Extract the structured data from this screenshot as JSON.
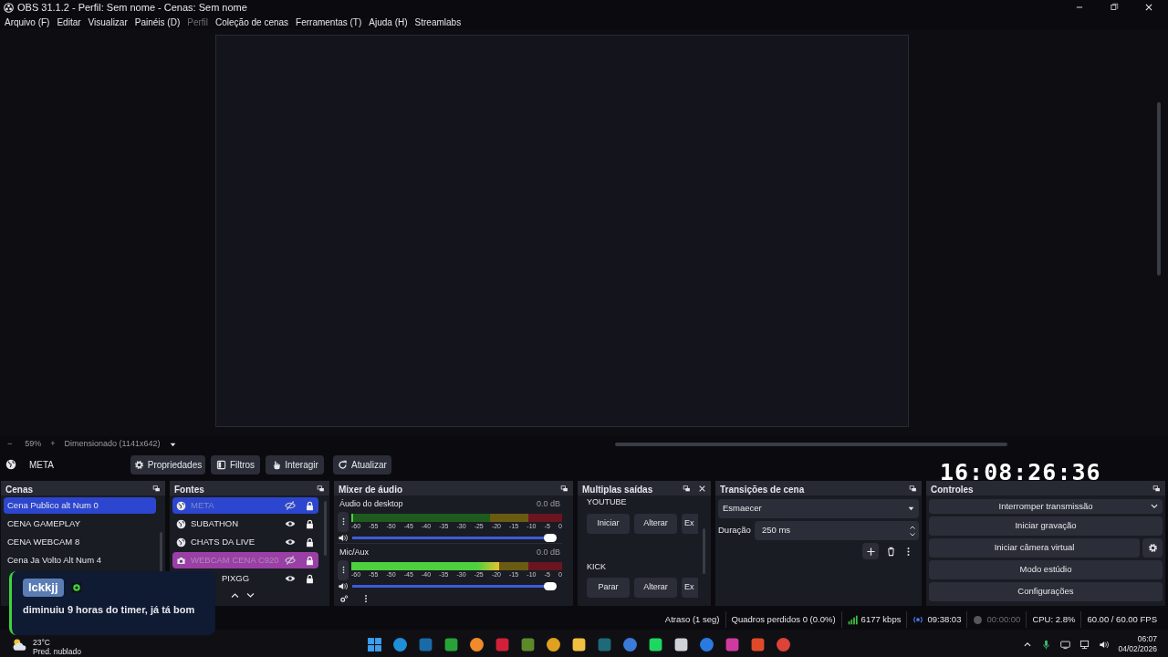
{
  "window": {
    "title": "OBS 31.1.2 - Perfil: Sem nome - Cenas: Sem nome"
  },
  "menu": [
    {
      "label": "Arquivo (F)",
      "disabled": false
    },
    {
      "label": "Editar",
      "disabled": false
    },
    {
      "label": "Visualizar",
      "disabled": false
    },
    {
      "label": "Painéis (D)",
      "disabled": false
    },
    {
      "label": "Perfil",
      "disabled": true
    },
    {
      "label": "Coleção de cenas",
      "disabled": false
    },
    {
      "label": "Ferramentas (T)",
      "disabled": false
    },
    {
      "label": "Ajuda (H)",
      "disabled": false
    },
    {
      "label": "Streamlabs",
      "disabled": false
    }
  ],
  "preview_bar": {
    "zoom_out": "−",
    "zoom": "59%",
    "zoom_in": "+",
    "mode": "Dimensionado (1141x642)"
  },
  "source_toolbar": {
    "source": "META",
    "buttons": [
      {
        "label": "Propriedades",
        "kind": "gear"
      },
      {
        "label": "Filtros",
        "kind": "filter"
      },
      {
        "label": "Interagir",
        "kind": "hand"
      },
      {
        "label": "Atualizar",
        "kind": "refresh"
      }
    ]
  },
  "clock": "16:08:26:36",
  "scenes": {
    "title": "Cenas",
    "items": [
      {
        "label": "Cena Publico alt Num 0",
        "selected": true
      },
      {
        "label": "CENA GAMEPLAY",
        "selected": false
      },
      {
        "label": "CENA WEBCAM 8",
        "selected": false
      },
      {
        "label": "Cena Ja Volto Alt Num 4",
        "selected": false
      }
    ]
  },
  "sources": {
    "title": "Fontes",
    "items": [
      {
        "label": "META",
        "kind": "browser",
        "visible": false,
        "locked": true,
        "selected": true,
        "covered": false
      },
      {
        "label": "SUBATHON",
        "kind": "browser",
        "visible": true,
        "locked": true,
        "selected": false,
        "covered": false
      },
      {
        "label": "CHATS DA LIVE",
        "kind": "browser",
        "visible": true,
        "locked": true,
        "selected": false,
        "covered": false
      },
      {
        "label": "WEBCAM CENA C920",
        "kind": "camera",
        "visible": false,
        "locked": true,
        "selected": false,
        "covered": false,
        "color": "#9a3fa6"
      },
      {
        "label": "PIXGG",
        "kind": "browser",
        "visible": true,
        "locked": true,
        "selected": false,
        "covered": true
      }
    ]
  },
  "mixer": {
    "title": "Mixer de áudio",
    "channels": [
      {
        "name": "Áudio do desktop",
        "reading": "0.0 dB",
        "meter": {
          "level": 0.01
        },
        "fader": {
          "level": 1
        },
        "scale": [
          "-60",
          "-55",
          "-50",
          "-45",
          "-40",
          "-35",
          "-30",
          "-25",
          "-20",
          "-15",
          "-10",
          "-5",
          "0"
        ]
      },
      {
        "name": "Mic/Aux",
        "reading": "0.0 dB",
        "meter": {
          "level": 0.7
        },
        "fader": {
          "level": 1
        },
        "scale": [
          "-60",
          "-55",
          "-50",
          "-45",
          "-40",
          "-35",
          "-30",
          "-25",
          "-20",
          "-15",
          "-10",
          "-5",
          "0"
        ]
      }
    ]
  },
  "outputs": {
    "title": "Multiplas saídas",
    "services": [
      {
        "name": "YOUTUBE",
        "buttons": [
          "Iniciar",
          "Alterar",
          "Ex"
        ]
      },
      {
        "name": "KICK",
        "buttons": [
          "Parar",
          "Alterar",
          "Ex"
        ]
      }
    ]
  },
  "transitions": {
    "title": "Transições de cena",
    "selected": "Esmaecer",
    "duration_label": "Duração",
    "duration": "250 ms"
  },
  "controls": {
    "title": "Controles",
    "buttons": [
      {
        "label": "Interromper transmissão",
        "kind": "dropdown"
      },
      {
        "label": "Iniciar gravação",
        "kind": "plain"
      },
      {
        "label": "Iniciar câmera virtual",
        "kind": "gear"
      },
      {
        "label": "Modo estúdio",
        "kind": "plain"
      },
      {
        "label": "Configurações",
        "kind": "plain"
      }
    ]
  },
  "status_bar": {
    "delay": "Atraso (1 seg)",
    "dropped": "Quadros perdidos 0 (0.0%)",
    "bitrate": "6177 kbps",
    "stream_time": "09:38:03",
    "record_time": "00:00:00",
    "cpu": "CPU: 2.8%",
    "fps": "60.00 / 60.00 FPS"
  },
  "notification": {
    "user": "lckkjj",
    "message": "diminuiu 9 horas do timer, já tá bom"
  },
  "taskbar": {
    "temperature": "23°C",
    "forecast": "Pred. nublado",
    "time": "06:07",
    "date": "04/02/2026"
  }
}
